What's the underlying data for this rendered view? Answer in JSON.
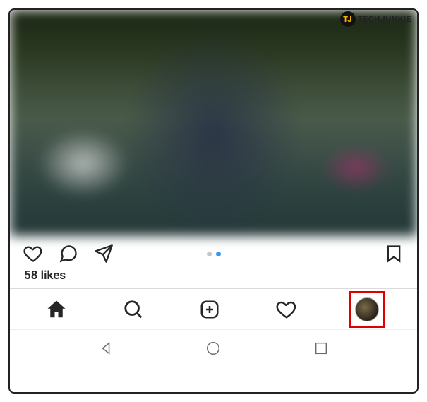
{
  "watermark": {
    "badge": "TJ",
    "text": "TECHJUNKIE"
  },
  "post": {
    "likes_text": "58 likes",
    "carousel": {
      "total": 2,
      "active_index": 1
    }
  },
  "actions": {
    "like": "like",
    "comment": "comment",
    "share": "share",
    "save": "save"
  },
  "tabs": {
    "home": "home",
    "search": "search",
    "create": "create",
    "activity": "activity",
    "profile": "profile"
  },
  "system_nav": {
    "back": "back",
    "home": "home",
    "recent": "recent"
  },
  "colors": {
    "highlight_box": "#e00000",
    "dot_active": "#3897f0",
    "dot_inactive": "#c7c7c7"
  }
}
